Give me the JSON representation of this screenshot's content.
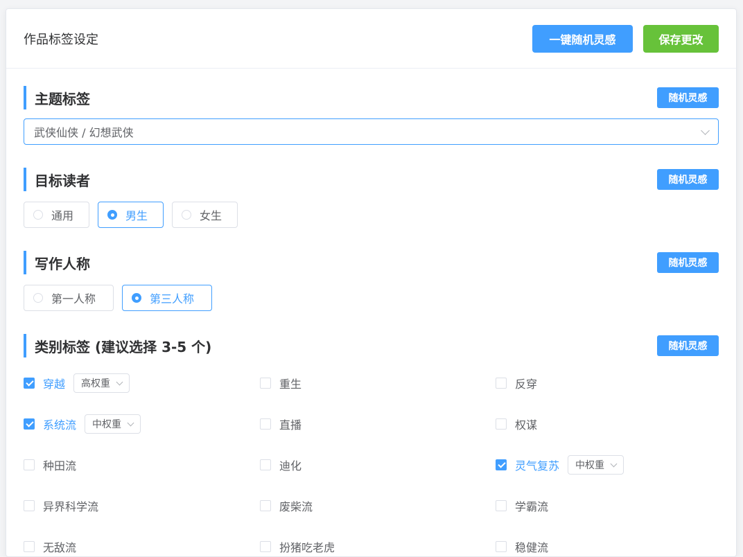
{
  "header": {
    "title": "作品标签设定",
    "random_all_label": "一键随机灵感",
    "save_label": "保存更改"
  },
  "colors": {
    "primary": "#409eff",
    "success": "#67c23a"
  },
  "sections": {
    "theme": {
      "title": "主题标签",
      "random_label": "随机灵感",
      "selected": "武侠仙侠 / 幻想武侠"
    },
    "audience": {
      "title": "目标读者",
      "random_label": "随机灵感",
      "options": [
        {
          "label": "通用",
          "checked": false
        },
        {
          "label": "男生",
          "checked": true
        },
        {
          "label": "女生",
          "checked": false
        }
      ]
    },
    "person": {
      "title": "写作人称",
      "random_label": "随机灵感",
      "options": [
        {
          "label": "第一人称",
          "checked": false
        },
        {
          "label": "第三人称",
          "checked": true
        }
      ]
    },
    "category": {
      "title": "类别标签 (建议选择 3-5 个)",
      "random_label": "随机灵感",
      "items": [
        {
          "label": "穿越",
          "checked": true,
          "weight": "高权重"
        },
        {
          "label": "重生",
          "checked": false
        },
        {
          "label": "反穿",
          "checked": false
        },
        {
          "label": "系统流",
          "checked": true,
          "weight": "中权重"
        },
        {
          "label": "直播",
          "checked": false
        },
        {
          "label": "权谋",
          "checked": false
        },
        {
          "label": "种田流",
          "checked": false
        },
        {
          "label": "迪化",
          "checked": false
        },
        {
          "label": "灵气复苏",
          "checked": true,
          "weight": "中权重"
        },
        {
          "label": "异界科学流",
          "checked": false
        },
        {
          "label": "废柴流",
          "checked": false
        },
        {
          "label": "学霸流",
          "checked": false
        },
        {
          "label": "无敌流",
          "checked": false
        },
        {
          "label": "扮猪吃老虎",
          "checked": false
        },
        {
          "label": "稳健流",
          "checked": false
        }
      ]
    }
  }
}
